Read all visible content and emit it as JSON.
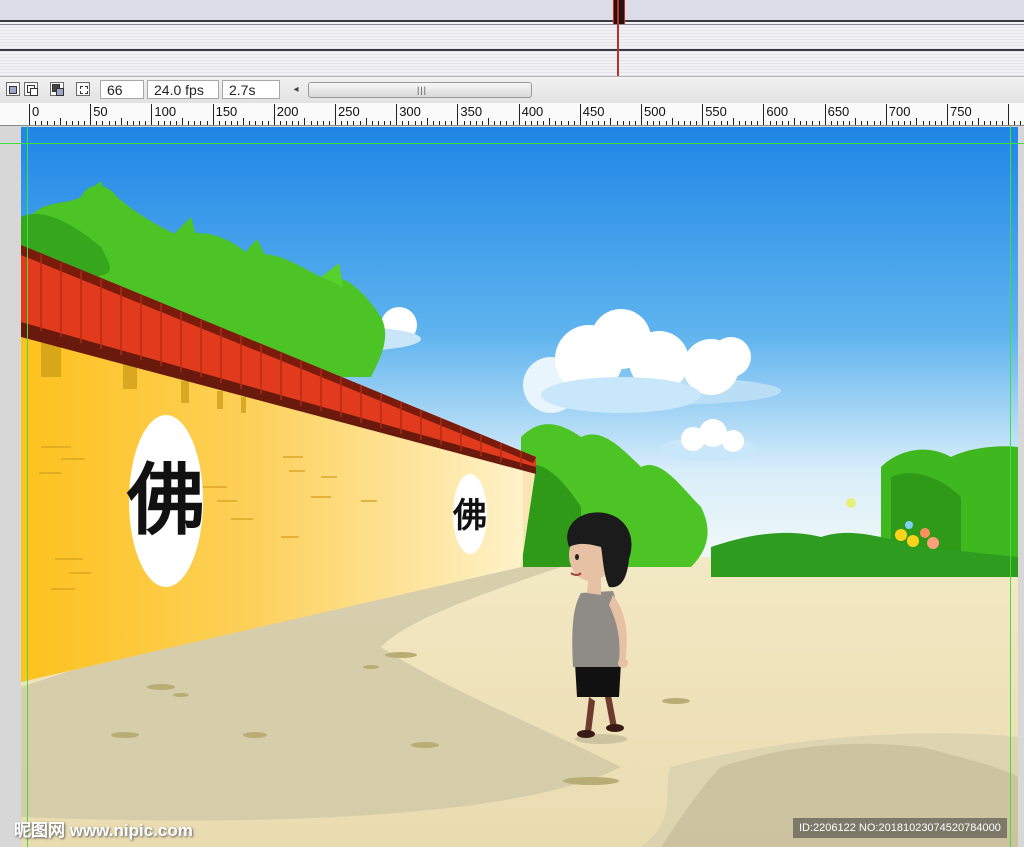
{
  "statusbar": {
    "frame": "66",
    "fps": "24.0 fps",
    "time": "2.7s",
    "scroll_left_arrow": "◂",
    "scroll_grip": "|||"
  },
  "ruler": {
    "labels": [
      "0",
      "50",
      "100",
      "150",
      "200",
      "250",
      "300",
      "350",
      "400",
      "450",
      "500",
      "550",
      "600",
      "650",
      "700",
      "750"
    ]
  },
  "stage": {
    "sign_large": "佛",
    "sign_small": "佛"
  },
  "colors": {
    "sky_top": "#1f86e6",
    "wall_yellow": "#fdc52a",
    "roof_red": "#e23a1d",
    "ground": "#ece1b8",
    "tree_green": "#4cc425",
    "guide_green": "#3ee03e"
  },
  "watermark": {
    "text": "昵图网 www.nipic.com",
    "id": "ID:2206122 NO:20181023074520784000"
  }
}
